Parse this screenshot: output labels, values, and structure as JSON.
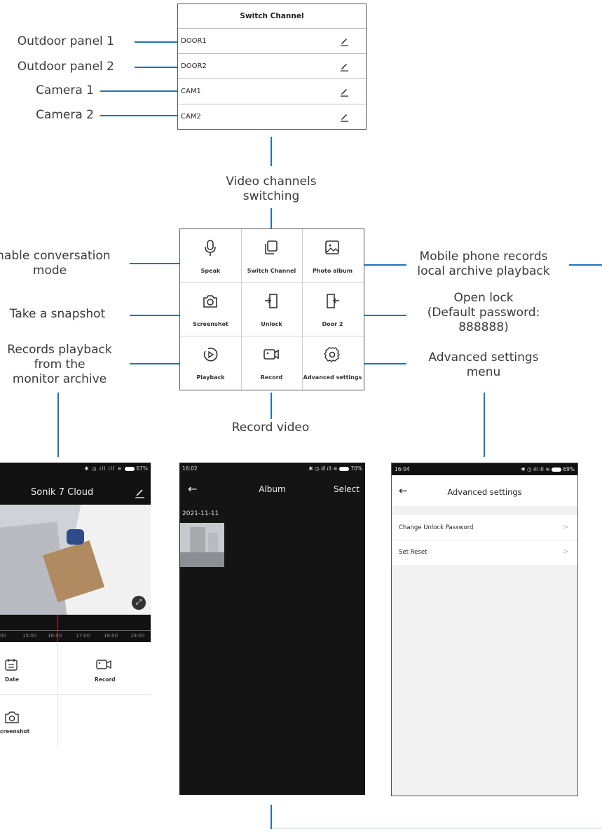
{
  "switch_channel": {
    "title": "Switch Channel",
    "channels": [
      "DOOR1",
      "DOOR2",
      "CAM1",
      "CAM2"
    ]
  },
  "annotations": {
    "outdoor1": "Outdoor panel 1",
    "outdoor2": "Outdoor panel 2",
    "camera1": "Camera 1",
    "camera2": "Camera 2",
    "video_switch": [
      "Video channels",
      "switching"
    ],
    "enable_conv": [
      "Enable conversation",
      "mode"
    ],
    "snapshot": "Take a snapshot",
    "records_playback": [
      "Records playback",
      "from the",
      "monitor archive"
    ],
    "mobile_records": [
      "Mobile phone records",
      "local archive playback"
    ],
    "open_lock": [
      "Open lock",
      "(Default password:",
      "888888)"
    ],
    "advanced_menu": [
      "Advanced settings",
      "menu"
    ],
    "record_video": "Record video"
  },
  "control_grid": {
    "items": [
      {
        "label": "Speak",
        "icon": "microphone-icon"
      },
      {
        "label": "Switch Channel",
        "icon": "switch-channel-icon"
      },
      {
        "label": "Photo album",
        "icon": "photo-album-icon"
      },
      {
        "label": "Screenshot",
        "icon": "camera-icon"
      },
      {
        "label": "Unlock",
        "icon": "unlock-icon"
      },
      {
        "label": "Door 2",
        "icon": "door-icon"
      },
      {
        "label": "Playback",
        "icon": "playback-icon"
      },
      {
        "label": "Record",
        "icon": "record-icon"
      },
      {
        "label": "Advanced settings",
        "icon": "gear-icon"
      }
    ]
  },
  "phone_playback": {
    "status_battery": "67%",
    "title": "Sonik 7 Cloud",
    "timeline_ticks": [
      "00",
      "15:00",
      "16:00",
      "17:00",
      "18:00",
      "19:00"
    ],
    "buttons": [
      {
        "label": "Date",
        "icon": "calendar-icon"
      },
      {
        "label": "Record",
        "icon": "record-icon"
      },
      {
        "label": "creenshot",
        "icon": "camera-icon"
      }
    ]
  },
  "phone_album": {
    "status_time": "16:02",
    "status_battery": "70%",
    "title": "Album",
    "select_label": "Select",
    "date": "2021-11-11"
  },
  "phone_advanced": {
    "status_time": "16:04",
    "status_battery": "69%",
    "title": "Advanced settings",
    "items": [
      "Change Unlock Password",
      "Set Reset"
    ]
  },
  "colors": {
    "accent_line": "#1f74b8",
    "dark_bg": "#111111"
  }
}
